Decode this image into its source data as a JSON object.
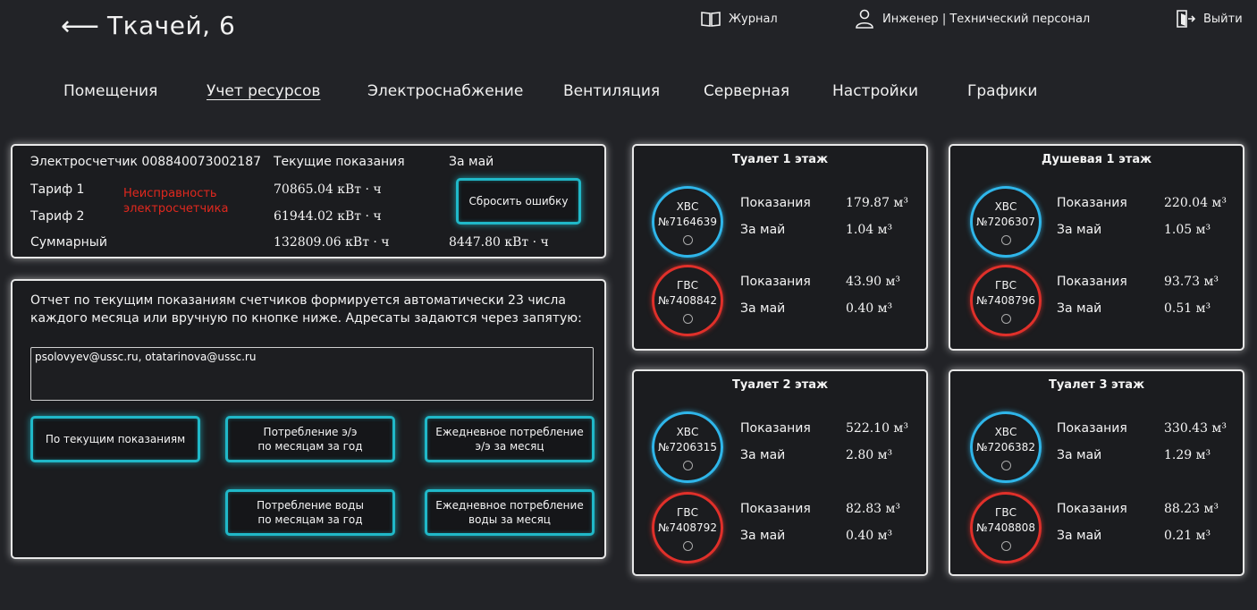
{
  "header": {
    "back_arrow": "⟵",
    "title": "Ткачей, 6",
    "journal": "Журнал",
    "user": "Инженер | Технический персонал",
    "logout": "Выйти"
  },
  "nav": {
    "tabs": [
      "Помещения",
      "Учет ресурсов",
      "Электроснабжение",
      "Вентиляция",
      "Серверная",
      "Настройки",
      "Графики"
    ],
    "active": "Учет ресурсов"
  },
  "electro": {
    "meter_label": "Электросчетчик 008840073002187",
    "current_header": "Текущие показания",
    "month_header": "За май",
    "tariff1_label": "Тариф 1",
    "tariff2_label": "Тариф 2",
    "total_label": "Суммарный",
    "error_text_line1": "Неисправность",
    "error_text_line2": "электросчетчика",
    "tariff1_value": "70865.04 кВт · ч",
    "tariff2_value": "61944.02 кВт · ч",
    "total_value": "132809.06 кВт · ч",
    "month_value": "8447.80 кВт · ч",
    "reset_button": "Сбросить ошибку"
  },
  "report": {
    "description": "Отчет по текущим показаниям счетчиков формируется автоматически 23 числа каждого месяца или вручную по кнопке ниже. Адресаты задаются через запятую:",
    "emails": "psolovyev@ussc.ru, otatarinova@ussc.ru",
    "btn_current": "По текущим показаниям",
    "btn_energy_year": "Потребление э/э\nпо месяцам за год",
    "btn_energy_daily": "Ежедневное потребление\nэ/э за месяц",
    "btn_water_year": "Потребление воды\nпо месяцам за год",
    "btn_water_daily": "Ежедневное потребление\nводы за месяц"
  },
  "rooms": [
    {
      "title": "Туалет 1 этаж",
      "cold": {
        "type": "ХВС",
        "number": "№7164639",
        "reading_label": "Показания",
        "reading": "179.87 м³",
        "month_label": "За май",
        "month": "1.04 м³"
      },
      "hot": {
        "type": "ГВС",
        "number": "№7408842",
        "reading_label": "Показания",
        "reading": "43.90 м³",
        "month_label": "За май",
        "month": "0.40 м³"
      }
    },
    {
      "title": "Душевая 1 этаж",
      "cold": {
        "type": "ХВС",
        "number": "№7206307",
        "reading_label": "Показания",
        "reading": "220.04 м³",
        "month_label": "За май",
        "month": "1.05 м³"
      },
      "hot": {
        "type": "ГВС",
        "number": "№7408796",
        "reading_label": "Показания",
        "reading": "93.73 м³",
        "month_label": "За май",
        "month": "0.51 м³"
      }
    },
    {
      "title": "Туалет 2 этаж",
      "cold": {
        "type": "ХВС",
        "number": "№7206315",
        "reading_label": "Показания",
        "reading": "522.10 м³",
        "month_label": "За май",
        "month": "2.80 м³"
      },
      "hot": {
        "type": "ГВС",
        "number": "№7408792",
        "reading_label": "Показания",
        "reading": "82.83 м³",
        "month_label": "За май",
        "month": "0.40 м³"
      }
    },
    {
      "title": "Туалет 3 этаж",
      "cold": {
        "type": "ХВС",
        "number": "№7206382",
        "reading_label": "Показания",
        "reading": "330.43 м³",
        "month_label": "За май",
        "month": "1.29 м³"
      },
      "hot": {
        "type": "ГВС",
        "number": "№7408808",
        "reading_label": "Показания",
        "reading": "88.23 м³",
        "month_label": "За май",
        "month": "0.21 м³"
      }
    }
  ],
  "colors": {
    "background": "#222327",
    "accent_cyan": "#20b8c8",
    "cold_water": "#2fb6ea",
    "hot_water": "#e0302a",
    "error": "#e0281e"
  },
  "icons": {
    "back": "arrow-left-icon",
    "journal": "book-icon",
    "user": "user-icon",
    "logout": "logout-icon"
  }
}
